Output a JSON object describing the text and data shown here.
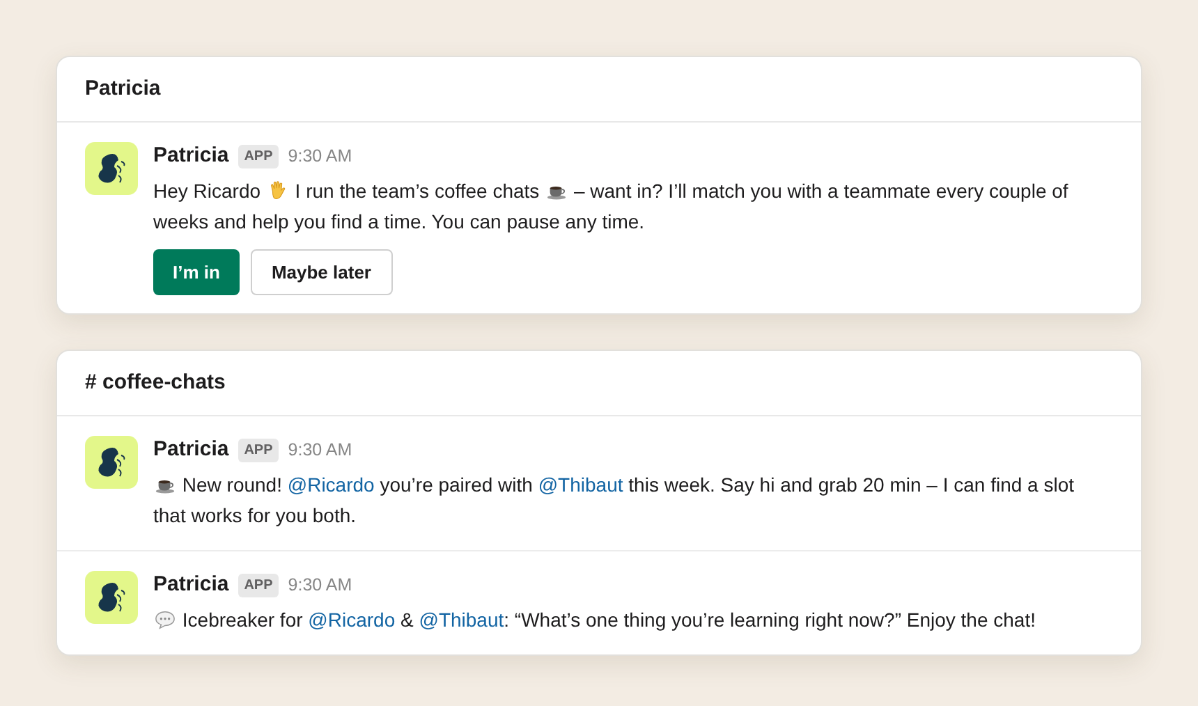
{
  "panels": [
    {
      "header": "Patricia",
      "messages": [
        {
          "author": "Patricia",
          "badge": "APP",
          "time": "9:30 AM",
          "segments": [
            {
              "kind": "text",
              "text": "Hey Ricardo "
            },
            {
              "kind": "wave"
            },
            {
              "kind": "text",
              "text": " I run the team’s coffee chats "
            },
            {
              "kind": "cup"
            },
            {
              "kind": "text",
              "text": " – want in? I’ll match you with a teammate every couple of weeks and help you find a time. You can pause any time."
            }
          ],
          "buttons": [
            {
              "label": "I’m in",
              "primary": true
            },
            {
              "label": "Maybe later",
              "primary": false
            }
          ]
        }
      ]
    },
    {
      "header": "# coffee-chats",
      "messages": [
        {
          "author": "Patricia",
          "badge": "APP",
          "time": "9:30 AM",
          "segments": [
            {
              "kind": "cup"
            },
            {
              "kind": "text",
              "text": " New round! "
            },
            {
              "kind": "mention",
              "text": "@Ricardo"
            },
            {
              "kind": "text",
              "text": " you’re paired with "
            },
            {
              "kind": "mention",
              "text": "@Thibaut"
            },
            {
              "kind": "text",
              "text": " this week. Say hi and grab 20 min – I can find a slot that works for you both."
            }
          ]
        },
        {
          "author": "Patricia",
          "badge": "APP",
          "time": "9:30 AM",
          "segments": [
            {
              "kind": "bubble"
            },
            {
              "kind": "text",
              "text": " Icebreaker for "
            },
            {
              "kind": "mention",
              "text": "@Ricardo"
            },
            {
              "kind": "text",
              "text": " & "
            },
            {
              "kind": "mention",
              "text": "@Thibaut"
            },
            {
              "kind": "text",
              "text": ": “What’s one thing you’re learning right now?” Enjoy the chat!"
            }
          ]
        }
      ]
    }
  ]
}
